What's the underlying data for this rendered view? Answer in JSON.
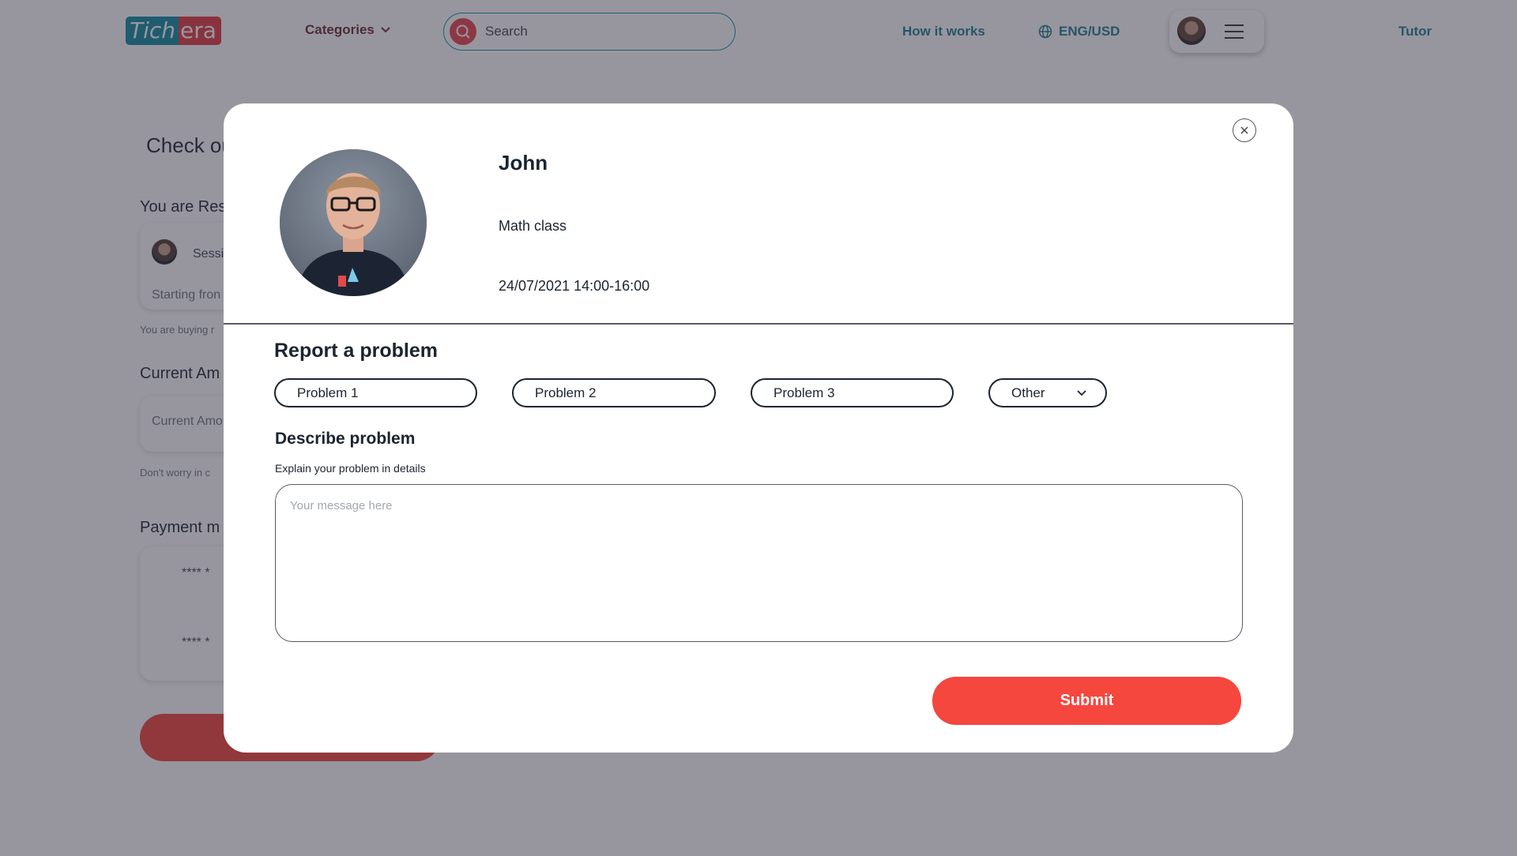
{
  "header": {
    "logo_part1": "Tich",
    "logo_part2": "era",
    "categories_label": "Categories",
    "search_placeholder": "Search",
    "how_it_works": "How it works",
    "language_currency": "ENG/USD",
    "tutor_link": "Tutor"
  },
  "checkout": {
    "title": "Check ou",
    "reserving_label": "You are Res",
    "session_text": "Sessi",
    "starting_text": "Starting fron",
    "buying_note": "You are buying r",
    "current_amount_label": "Current Am",
    "current_amount_placeholder": "Current Amo",
    "worry_note": "Don't worry in c",
    "payment_label": "Payment  m",
    "card1": "**** *",
    "card2": "**** *"
  },
  "modal": {
    "tutor_name": "John",
    "class_name": "Math class",
    "session_datetime": "24/07/2021 14:00-16:00",
    "report_title": "Report a problem",
    "problem_options": [
      "Problem 1",
      "Problem 2",
      "Problem 3"
    ],
    "other_option": "Other",
    "describe_title": "Describe problem",
    "describe_subtitle": "Explain your problem in details",
    "message_placeholder": "Your message here",
    "submit_label": "Submit"
  },
  "colors": {
    "brand_teal": "#0f8aa0",
    "brand_red": "#e0383e",
    "submit_red": "#f5473e",
    "overlay": "#302d3e"
  }
}
